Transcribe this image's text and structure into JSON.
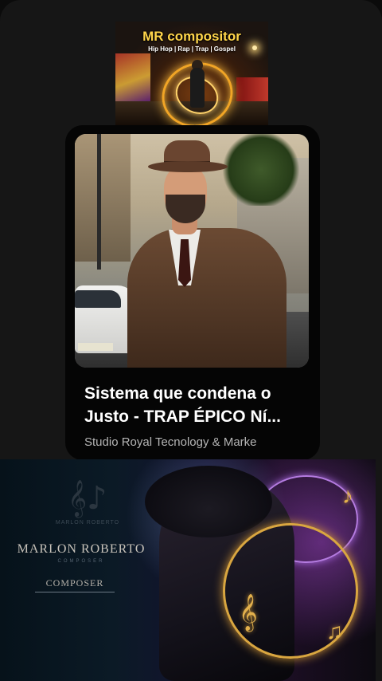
{
  "banner": {
    "title": "MR compositor",
    "subtitle": "Hip Hop | Rap | Trap | Gospel"
  },
  "video": {
    "title_line1": "Sistema que condena o",
    "title_line2": "Justo - TRAP ÉPICO Ní...",
    "channel": "Studio Royal Tecnology & Marke"
  },
  "composer_banner": {
    "logo_small_text": "MARLON ROBERTO",
    "name": "MARLON ROBERTO",
    "name_sub": "COMPOSER",
    "role": "COMPOSER"
  },
  "icons": {
    "treble_clef": "treble-clef-icon",
    "music_note": "music-note-icon"
  }
}
